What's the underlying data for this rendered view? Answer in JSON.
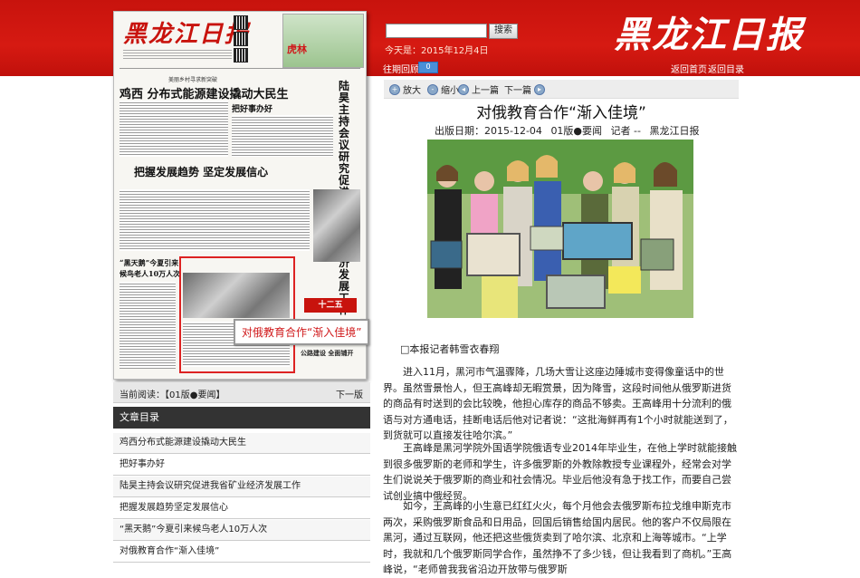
{
  "header": {
    "logo_text": "黑龙江日报",
    "search_button": "搜索",
    "search_value": "",
    "today_label": "今天是：2015年12月4日",
    "past_label": "往期回顾",
    "past_select_value": "0",
    "home_link": "返回首页",
    "dir_link": "返回目录"
  },
  "newspaper": {
    "masthead": "黑龙江日报",
    "ad_text": "虎林",
    "head_small": "美丽乡村寻求新突破",
    "head1": "鸡西  分布式能源建设撬动大民生",
    "head2": "把好事办好",
    "vertical_head": "陆昊主持会议研究促进我省矿业经济发展工作",
    "head3": "把握发展趋势  坚定发展信心",
    "small_head1": "“黑天鹅”今夏引来",
    "small_head2": "候鸟老人10万人次",
    "banner": "十二五",
    "bottom_head": "公路建设  全面铺开",
    "tooltip": "对俄教育合作“渐入佳境”"
  },
  "toolbar": {
    "zoom_in": "放大",
    "zoom_out": "缩小",
    "prev": "上一篇",
    "next": "下一篇"
  },
  "article": {
    "title": "对俄教育合作“渐入佳境”",
    "meta_date": "出版日期：2015-12-04",
    "meta_edition": "01版●要闻",
    "meta_author": "记者 --",
    "meta_source": "黑龙江日报",
    "byline": "□本报记者韩雪衣春翔",
    "paragraphs": [
      "进入11月，黑河市气温骤降，几场大雪让这座边陲城市变得像童话中的世界。虽然雪景怡人，但王高峰却无暇赏景，因为降雪，这段时间他从俄罗斯进货的商品有时送到的会比较晚，他担心库存的商品不够卖。王高峰用十分流利的俄语与对方通电话，挂断电话后他对记者说：“这批海鲜再有1个小时就能送到了，到货就可以直接发往哈尔滨。”",
      "王高峰是黑河学院外国语学院俄语专业2014年毕业生，在他上学时就能接触到很多俄罗斯的老师和学生，许多俄罗斯的外教除教授专业课程外，经常会对学生们说说关于俄罗斯的商业和社会情况。毕业后他没有急于找工作，而要自己尝试创业搞中俄经贸。",
      "如今，王高峰的小生意已红红火火，每个月他会去俄罗斯布拉戈维申斯克市两次，采购俄罗斯食品和日用品，回国后销售给国内居民。他的客户不仅局限在黑河，通过互联网，他还把这些俄货卖到了哈尔滨、北京和上海等城市。“上学时，我就和几个俄罗斯同学合作，虽然挣不了多少钱，但让我看到了商机。”王高峰说，“老师曾我我省沿边开放带与俄罗斯"
    ]
  },
  "left_panel": {
    "current_label": "当前阅读：【01版●要闻】",
    "next_label": "下一版",
    "toc_header": "文章目录",
    "toc_items": [
      "鸡西分布式能源建设撬动大民生",
      "把好事办好",
      "陆昊主持会议研究促进我省矿业经济发展工作",
      "把握发展趋势坚定发展信心",
      "“黑天鹅”今夏引来候鸟老人10万人次",
      "对俄教育合作“渐入佳境”"
    ]
  }
}
